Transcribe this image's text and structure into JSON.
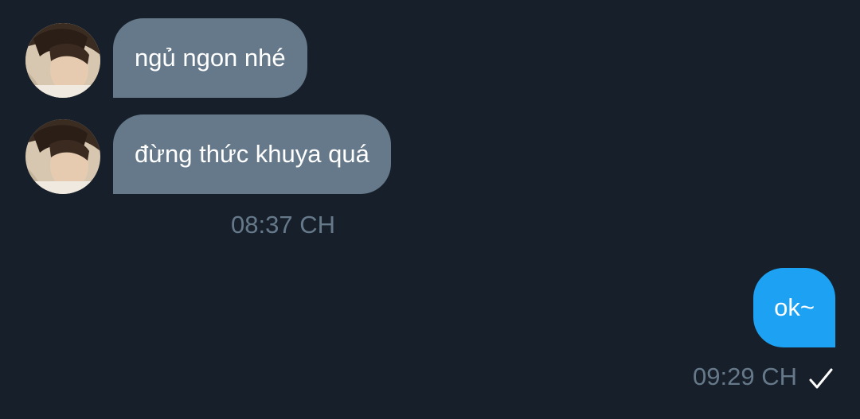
{
  "conversation": {
    "incoming": [
      {
        "text": "ngủ ngon nhé",
        "avatar_icon": "contact-avatar-photo"
      },
      {
        "text": "đừng thức khuya quá",
        "avatar_icon": "contact-avatar-photo"
      }
    ],
    "incoming_timestamp": "08:37 CH",
    "outgoing": [
      {
        "text": "ok~"
      }
    ],
    "outgoing_timestamp": "09:29 CH",
    "outgoing_status_icon": "checkmark-icon"
  },
  "colors": {
    "background": "#17202a",
    "incoming_bubble": "#66798a",
    "outgoing_bubble": "#1da1f2",
    "timestamp_text": "#66798a"
  }
}
